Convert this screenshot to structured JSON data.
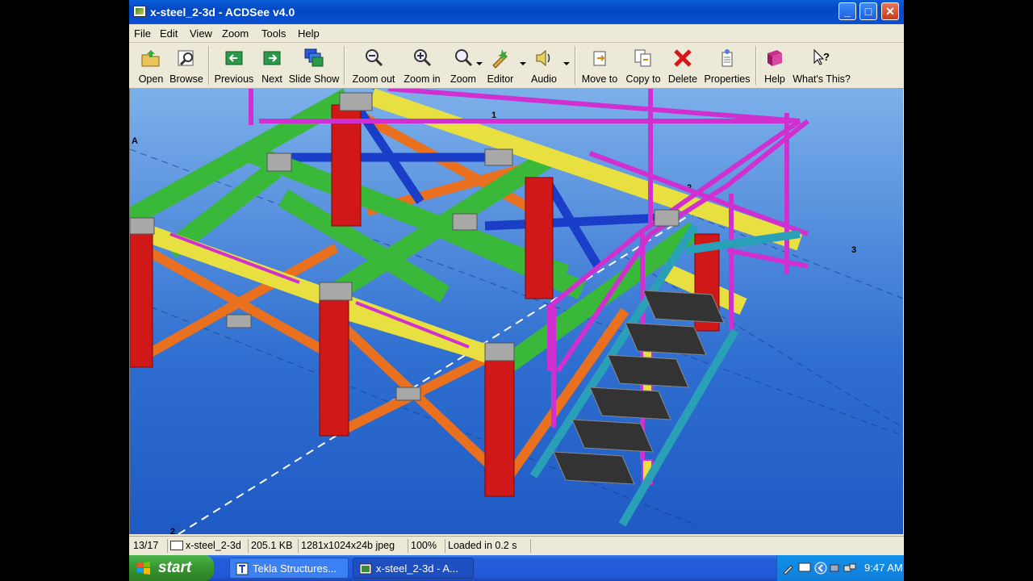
{
  "window": {
    "title": "x-steel_2-3d - ACDSee v4.0",
    "controls": {
      "minimize": "_",
      "maximize": "□",
      "close": "✕"
    }
  },
  "menu": [
    "File",
    "Edit",
    "View",
    "Zoom",
    "Tools",
    "Help"
  ],
  "toolbar": {
    "open": "Open",
    "browse": "Browse",
    "previous": "Previous",
    "next": "Next",
    "slideshow": "Slide Show",
    "zoom_out": "Zoom out",
    "zoom_in": "Zoom in",
    "zoom": "Zoom",
    "editor": "Editor",
    "audio": "Audio",
    "move_to": "Move to",
    "copy_to": "Copy to",
    "delete": "Delete",
    "properties": "Properties",
    "help": "Help",
    "whats_this": "What's This?"
  },
  "viewer": {
    "grid_labels": {
      "a": "A",
      "one": "1",
      "two": "2",
      "three": "3",
      "two_bottom": "2"
    },
    "colors": {
      "background": "#3f7fd8",
      "column_red": "#d01818",
      "beam_green": "#3ab83a",
      "beam_yellow": "#e8e040",
      "brace_orange": "#e8701e",
      "brace_blue": "#1a3ec8",
      "rail_magenta": "#d030d0",
      "stair_teal": "#2aa0b8"
    }
  },
  "status": {
    "index": "13/17",
    "filename": "x-steel_2-3d",
    "filesize": "205.1 KB",
    "dimensions": "1281x1024x24b jpeg",
    "zoom": "100%",
    "load_time": "Loaded in 0.2 s"
  },
  "taskbar": {
    "start": "start",
    "tasks": [
      {
        "label": "Tekla Structures..."
      },
      {
        "label": "x-steel_2-3d - A..."
      }
    ],
    "clock": "9:47 AM"
  }
}
